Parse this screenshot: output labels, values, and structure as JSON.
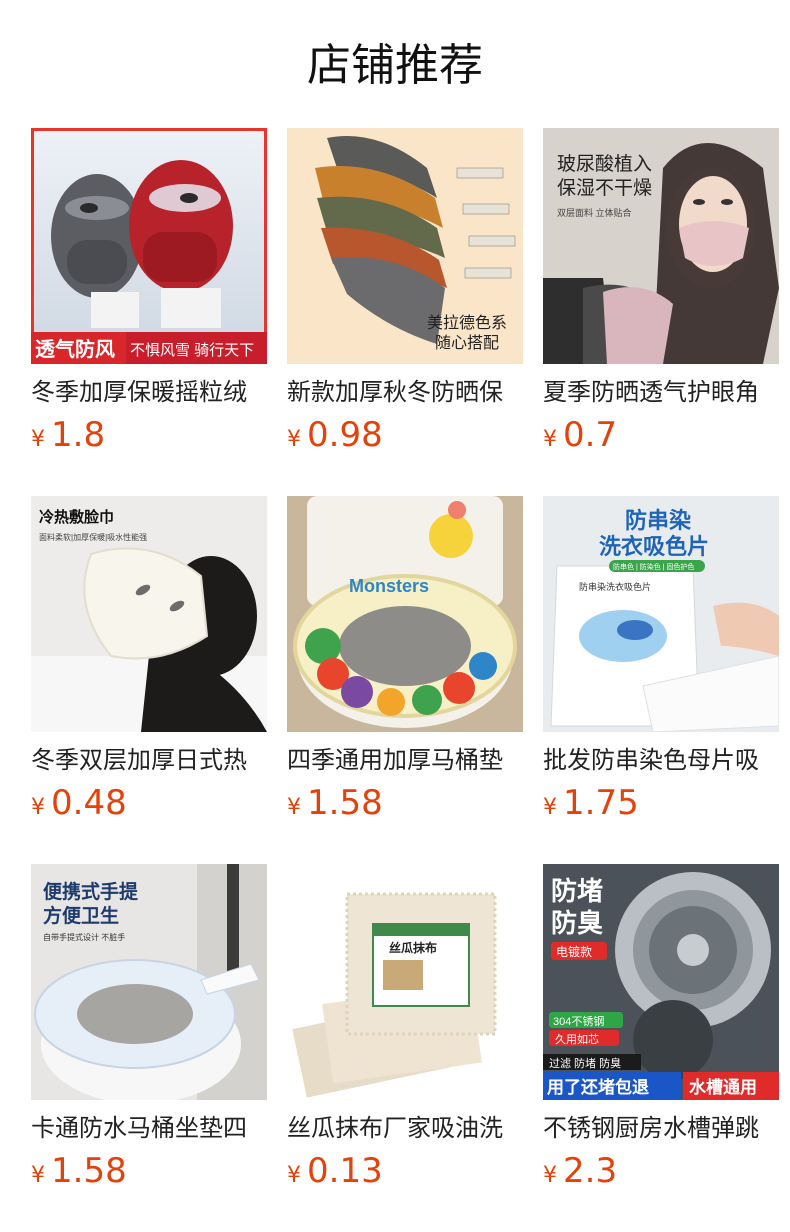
{
  "page": {
    "title": "店铺推荐"
  },
  "colors": {
    "price": "#e4420b",
    "title": "#111111",
    "text": "#222222",
    "background": "#ffffff"
  },
  "currency_symbol": "¥",
  "products": [
    {
      "name": "冬季加厚保暖摇粒绒",
      "price": "1.8",
      "image_icon": "face-mask-thermal-icon",
      "image_text": {
        "badge1": "透气防风",
        "badge2": "不惧风雪 骑行天下"
      }
    },
    {
      "name": "新款加厚秋冬防晒保",
      "price": "0.98",
      "image_icon": "face-mask-stack-icon",
      "image_text": {
        "line1": "美拉德色系",
        "line2": "随心搭配"
      }
    },
    {
      "name": "夏季防晒透气护眼角",
      "price": "0.7",
      "image_icon": "face-mask-pink-icon",
      "image_text": {
        "line1": "玻尿酸植入",
        "line2": "保湿不干燥",
        "line3": "双层面料 立体贴合"
      }
    },
    {
      "name": "冬季双层加厚日式热",
      "price": "0.48",
      "image_icon": "face-towel-icon",
      "image_text": {
        "line1": "冷热敷脸巾",
        "line2": "面料柔软|加厚保暖|吸水性能强"
      }
    },
    {
      "name": "四季通用加厚马桶垫",
      "price": "1.58",
      "image_icon": "toilet-seat-cushion-icon",
      "image_text": {
        "line1": "Monsters"
      }
    },
    {
      "name": "批发防串染色母片吸",
      "price": "1.75",
      "image_icon": "color-catcher-sheet-icon",
      "image_text": {
        "line1": "防串染",
        "line2": "洗衣吸色片",
        "line3": "防串色 | 防染色 | 固色护色",
        "line4": "防串染洗衣吸色片"
      }
    },
    {
      "name": "卡通防水马桶坐垫四",
      "price": "1.58",
      "image_icon": "disposable-toilet-pad-icon",
      "image_text": {
        "line1": "便携式手提",
        "line2": "方便卫生",
        "line3": "自带手提式设计 不脏手"
      }
    },
    {
      "name": "丝瓜抹布厂家吸油洗",
      "price": "0.13",
      "image_icon": "loofah-cloth-icon",
      "image_text": {
        "line1": "丝瓜抹布"
      }
    },
    {
      "name": "不锈钢厨房水槽弹跳",
      "price": "2.3",
      "image_icon": "sink-strainer-icon",
      "image_text": {
        "line1": "防堵",
        "line2": "防臭",
        "line3": "电镀款",
        "line4": "304不锈钢",
        "line5": "久用如芯",
        "line6": "过滤 防堵 防臭",
        "line7": "用了还堵包退",
        "line8": "水槽通用"
      }
    }
  ]
}
